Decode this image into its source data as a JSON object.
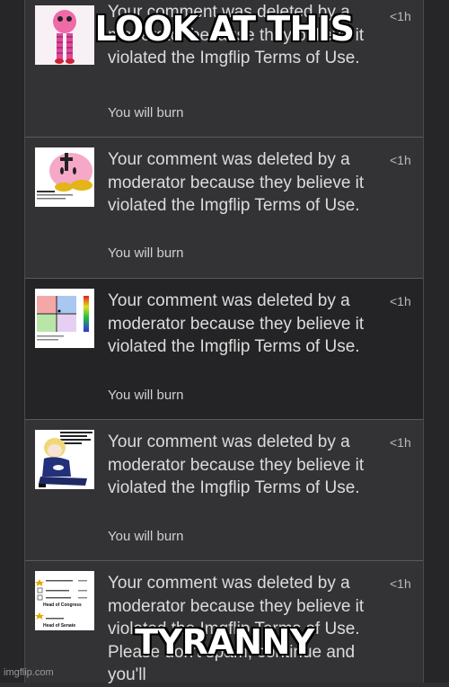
{
  "meme": {
    "top_text": "LOOK AT THIS",
    "bottom_text": "TYRANNY"
  },
  "watermark": "imgflip.com",
  "notifications": [
    {
      "message": "Your comment was deleted by a moderator because they believe it violated the Imgflip Terms of Use.",
      "sub": "You will burn",
      "time": "<1h",
      "thumb_icon": "pink-character-thumbnail"
    },
    {
      "message": "Your comment was deleted by a moderator because they believe it violated the Imgflip Terms of Use.",
      "sub": "You will burn",
      "time": "<1h",
      "thumb_icon": "kirby-cross-thumbnail",
      "thumb_caption": "Post a Kirby but make it fancy"
    },
    {
      "message": "Your comment was deleted by a moderator because they believe it violated the Imgflip Terms of Use.",
      "sub": "You will burn",
      "time": "<1h",
      "thumb_icon": "political-compass-thumbnail"
    },
    {
      "message": "Your comment was deleted by a moderator because they believe it violated the Imgflip Terms of Use.",
      "sub": "You will burn",
      "time": "<1h",
      "thumb_icon": "anime-girl-thumbnail",
      "thumb_caption": "voting has ended, results will be tallied shortly"
    },
    {
      "message": "Your comment was deleted by a moderator because they believe it violated the Imgflip Terms of Use. Please don't spam, continue and you'll",
      "sub": "",
      "time": "<1h",
      "thumb_icon": "ballot-thumbnail",
      "thumb_labels": [
        "Head of Congress",
        "Head of Senate"
      ]
    }
  ]
}
